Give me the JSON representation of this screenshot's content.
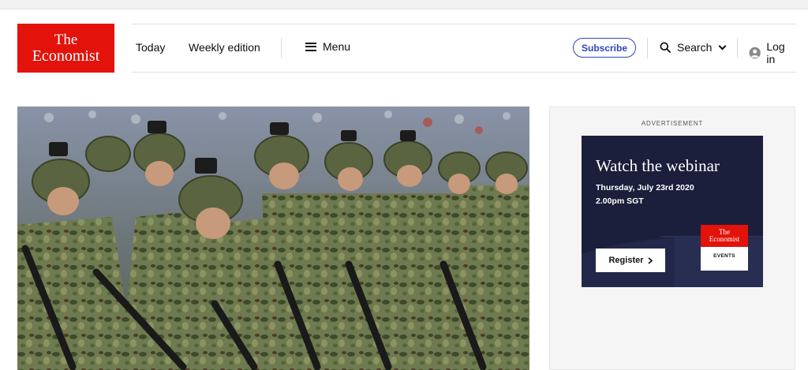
{
  "brand": {
    "logo_line1": "The",
    "logo_line2": "Economist",
    "color": "#e3120b"
  },
  "nav": {
    "today": "Today",
    "weekly": "Weekly edition",
    "menu": "Menu",
    "subscribe": "Subscribe",
    "search": "Search",
    "login": "Log in",
    "accent": "#2e45b8"
  },
  "icons": [
    "hamburger-icon",
    "search-icon",
    "chevron-down-icon",
    "user-icon",
    "chevron-right-icon"
  ],
  "hero": {
    "image": "soldiers-in-camouflage-marching"
  },
  "advert": {
    "label": "ADVERTISEMENT",
    "title": "Watch the webinar",
    "date": "Thursday, July 23rd 2020",
    "time": "2.00pm SGT",
    "button": "Register",
    "logo_line1": "The",
    "logo_line2": "Economist",
    "logo_sub": "EVENTS",
    "bg": "#1b1f3b"
  }
}
